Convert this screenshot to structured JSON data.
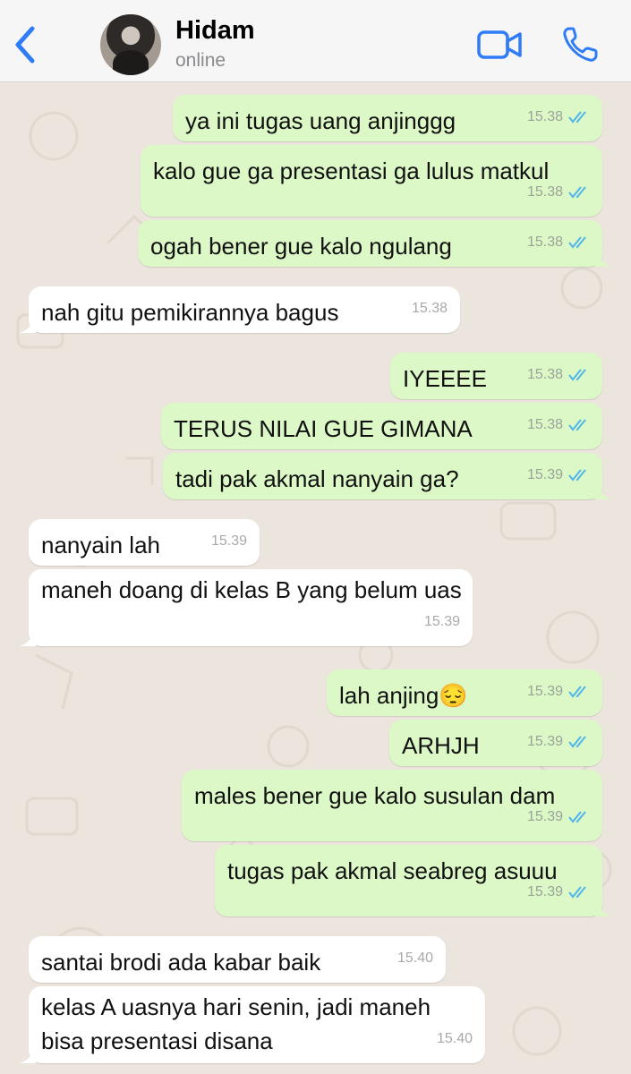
{
  "contact": {
    "name": "Hidam",
    "status": "online"
  },
  "icons": {
    "back": "chevron-left-icon",
    "video": "video-camera-icon",
    "call": "phone-icon",
    "read": "double-check-icon"
  },
  "colors": {
    "accent": "#2f7cf6",
    "outgoing_bubble": "#dcf8c6",
    "incoming_bubble": "#ffffff",
    "read_ticks": "#4fb6ec",
    "chat_background": "#ece5dd"
  },
  "messages": [
    {
      "direction": "out",
      "text": "ya ini tugas uang anjinggg",
      "time": "15.38",
      "status": "read"
    },
    {
      "direction": "out",
      "text": "kalo gue ga presentasi ga lulus matkul",
      "time": "15.38",
      "status": "read"
    },
    {
      "direction": "out",
      "text": "ogah bener gue kalo ngulang",
      "time": "15.38",
      "status": "read"
    },
    {
      "direction": "in",
      "text": "nah gitu pemikirannya bagus",
      "time": "15.38"
    },
    {
      "direction": "out",
      "text": "IYEEEE",
      "time": "15.38",
      "status": "read"
    },
    {
      "direction": "out",
      "text": "TERUS NILAI GUE GIMANA",
      "time": "15.38",
      "status": "read"
    },
    {
      "direction": "out",
      "text": "tadi pak akmal nanyain ga?",
      "time": "15.39",
      "status": "read"
    },
    {
      "direction": "in",
      "text": "nanyain lah",
      "time": "15.39"
    },
    {
      "direction": "in",
      "text": "maneh doang di kelas B yang belum uas",
      "time": "15.39"
    },
    {
      "direction": "out",
      "text": "lah anjing😔",
      "time": "15.39",
      "status": "read"
    },
    {
      "direction": "out",
      "text": "ARHJH",
      "time": "15.39",
      "status": "read"
    },
    {
      "direction": "out",
      "text": "males bener gue kalo susulan dam",
      "time": "15.39",
      "status": "read"
    },
    {
      "direction": "out",
      "text": "tugas pak akmal seabreg asuuu",
      "time": "15.39",
      "status": "read"
    },
    {
      "direction": "in",
      "text": "santai brodi ada kabar baik",
      "time": "15.40"
    },
    {
      "direction": "in",
      "text": "kelas A uasnya hari senin, jadi maneh bisa presentasi disana",
      "time": "15.40"
    }
  ]
}
